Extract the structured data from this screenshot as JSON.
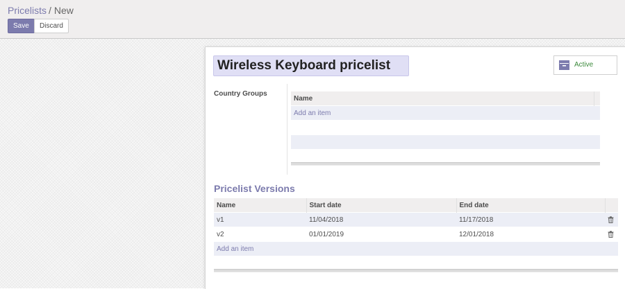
{
  "breadcrumb": {
    "parent": "Pricelists",
    "separator": "/",
    "current": "New"
  },
  "toolbar": {
    "save_label": "Save",
    "discard_label": "Discard"
  },
  "form": {
    "name_value": "Wireless Keyboard pricelist",
    "active_label": "Active",
    "country_groups": {
      "label": "Country Groups",
      "column_header": "Name",
      "add_item_label": "Add an item"
    },
    "versions": {
      "title": "Pricelist Versions",
      "columns": [
        "Name",
        "Start date",
        "End date"
      ],
      "rows": [
        {
          "name": "v1",
          "start": "11/04/2018",
          "end": "11/17/2018"
        },
        {
          "name": "v2",
          "start": "01/01/2019",
          "end": "12/01/2018"
        }
      ],
      "add_item_label": "Add an item"
    }
  },
  "colors": {
    "accent": "#7c7bad",
    "active_green": "#3c8a3c",
    "name_bg": "#e0dff5"
  }
}
